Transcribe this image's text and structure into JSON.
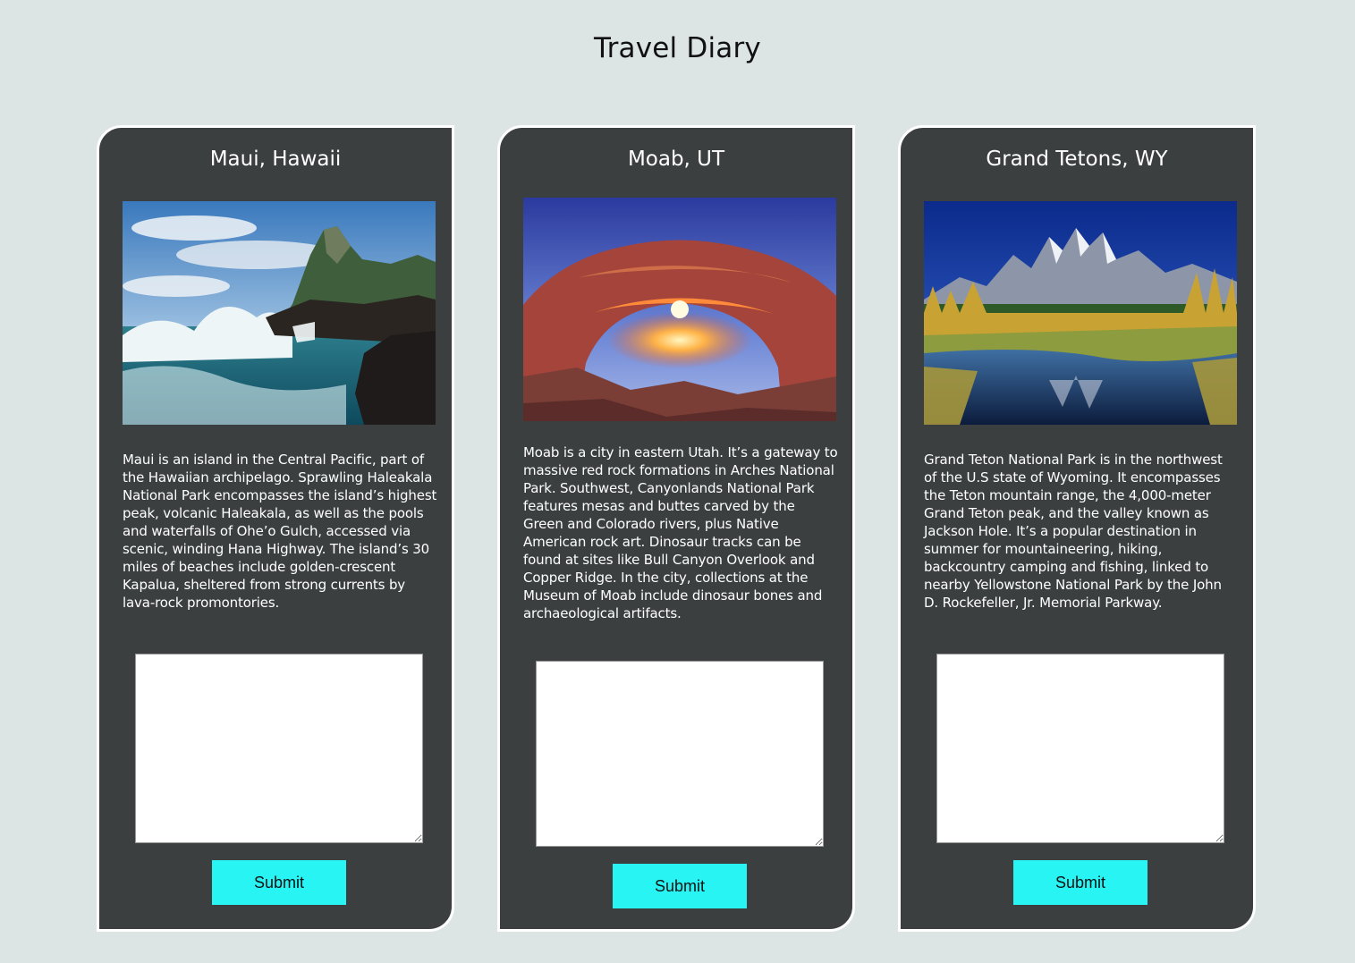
{
  "header": {
    "title": "Travel Diary"
  },
  "cards": [
    {
      "title": "Maui, Hawaii",
      "description": "Maui is an island in the Central Pacific, part of the Hawaiian archipelago. Sprawling Haleakala National Park encompasses the island’s highest peak, volcanic Haleakala, as well as the pools and waterfalls of Ohe’o Gulch, accessed via scenic, winding Hana Highway. The island’s 30 miles of beaches include golden-crescent Kapalua, sheltered from strong currents by lava-rock promontories.",
      "entry_value": "",
      "submit_label": "Submit"
    },
    {
      "title": "Moab, UT",
      "description": "Moab is a city in eastern Utah. It’s a gateway to massive red rock formations in Arches National Park. Southwest, Canyonlands National Park features mesas and buttes carved by the Green and Colorado rivers, plus Native American rock art. Dinosaur tracks can be found at sites like Bull Canyon Overlook and Copper Ridge. In the city, collections at the Museum of Moab include dinosaur bones and archaeological artifacts.",
      "entry_value": "",
      "submit_label": "Submit"
    },
    {
      "title": "Grand Tetons, WY",
      "description": "Grand Teton National Park is in the northwest of the U.S state of Wyoming. It encompasses the Teton mountain range, the 4,000-meter Grand Teton peak, and the valley known as Jackson Hole. It’s a popular destination in summer for mountaineering, hiking, backcountry camping and fishing, linked to nearby Yellowstone National Park by the John D. Rockefeller, Jr. Memorial Parkway.",
      "entry_value": "",
      "submit_label": "Submit"
    }
  ],
  "colors": {
    "page_background": "#dce5e4",
    "card_background": "#3b3f40",
    "card_border": "#ffffff",
    "button_background": "#29f4f4"
  }
}
